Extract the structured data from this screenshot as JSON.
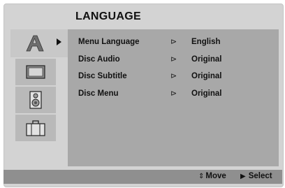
{
  "title": "LANGUAGE",
  "tabs": [
    {
      "icon": "language-letter-icon",
      "active": true
    },
    {
      "icon": "display-screen-icon",
      "active": false
    },
    {
      "icon": "speaker-icon",
      "active": false
    },
    {
      "icon": "briefcase-icon",
      "active": false
    }
  ],
  "menu": [
    {
      "label": "Menu Language",
      "value": "English"
    },
    {
      "label": "Disc Audio",
      "value": "Original"
    },
    {
      "label": "Disc Subtitle",
      "value": "Original"
    },
    {
      "label": "Disc Menu",
      "value": "Original"
    }
  ],
  "pointer_glyph": "⊳",
  "footer": {
    "move_glyph": "⇕",
    "move_label": "Move",
    "select_glyph": "▶",
    "select_label": "Select"
  },
  "colors": {
    "frame": "#d3d3d3",
    "panel": "#a8a8a8",
    "footer": "#8f8f8f",
    "text": "#111111"
  }
}
